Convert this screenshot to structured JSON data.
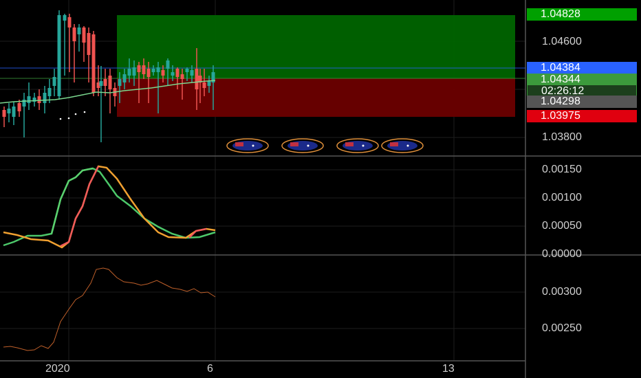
{
  "price_axis": {
    "ticks": [
      "1.04600",
      "1.03800"
    ],
    "labels": [
      {
        "name": "target-price",
        "text": "1.04828",
        "bg": "#00a000"
      },
      {
        "name": "last-price",
        "text": "1.04384",
        "bg": "#2962ff"
      },
      {
        "name": "entry-price",
        "text": "1.04344",
        "bg": "#3c9a3c"
      },
      {
        "name": "countdown",
        "text": "02:26:12",
        "bg": "#1c3f1c"
      },
      {
        "name": "close-price",
        "text": "1.04298",
        "bg": "#555555"
      },
      {
        "name": "stop-price",
        "text": "1.03975",
        "bg": "#e0000f"
      }
    ]
  },
  "indicator1_axis": {
    "ticks": [
      "0.00150",
      "0.00100",
      "0.00050",
      "0.00000"
    ]
  },
  "indicator2_axis": {
    "ticks": [
      "0.00300",
      "0.00250"
    ]
  },
  "time_axis": {
    "ticks": [
      "2020",
      "6",
      "13"
    ]
  },
  "position": {
    "target": 1.04828,
    "entry": 1.04344,
    "stop": 1.03975
  },
  "colors": {
    "up": "#26a69a",
    "down": "#ef5350",
    "profit": "#006400",
    "loss": "#6b0000"
  },
  "event_markers": [
    {
      "icon": "australia-flag-icon"
    },
    {
      "icon": "australia-flag-icon"
    },
    {
      "icon": "australia-flag-icon"
    },
    {
      "icon": "australia-flag-icon"
    }
  ]
}
